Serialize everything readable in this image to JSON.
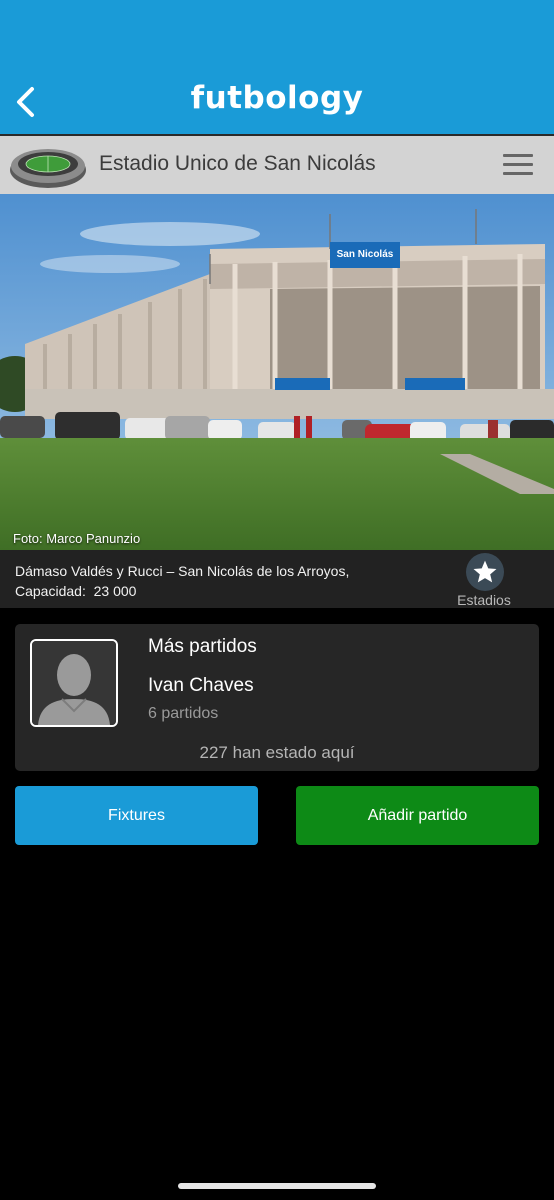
{
  "app": {
    "brand": "futbology"
  },
  "colors": {
    "primary": "#1a9bd7",
    "add_button": "#0d8a16",
    "card_bg": "#262626",
    "header_bg": "#d3d3d3"
  },
  "nav": {
    "back_icon": "chevron-left-icon",
    "menu_icon": "hamburger-menu-icon"
  },
  "stadium": {
    "name": "Estadio Unico de San Nicolás",
    "photo_credit": "Foto: Marco Panunzio",
    "signage": "San Nicolás",
    "address": "Dámaso Valdés y Rucci – San Nicolás de los Arroyos,",
    "capacity_label": "Capacidad:",
    "capacity_value": "23 000",
    "favorite_icon": "star-icon",
    "favorite_label": "Estadios"
  },
  "more_matches": {
    "title": "Más partidos",
    "user_name": "Ivan Chaves",
    "match_count": "6 partidos",
    "visitors": "227 han estado aquí"
  },
  "actions": {
    "fixtures_label": "Fixtures",
    "add_match_label": "Añadir partido"
  }
}
